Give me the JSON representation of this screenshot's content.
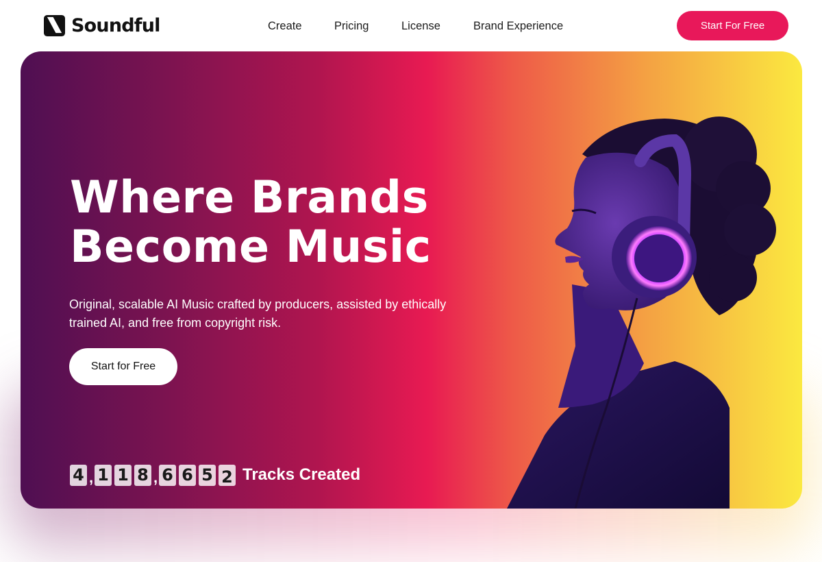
{
  "header": {
    "logo_text": "Soundful",
    "nav": [
      "Create",
      "Pricing",
      "License",
      "Brand Experience"
    ],
    "cta_label": "Start For Free",
    "cta_color": "#e8185a"
  },
  "hero": {
    "title_line1": "Where Brands",
    "title_line2": "Become Music",
    "subtitle": "Original, scalable AI Music crafted by producers, assisted by ethically trained AI, and free from copyright risk.",
    "cta_label": "Start for Free",
    "counter": {
      "digits": [
        "4",
        "1",
        "1",
        "8",
        "6",
        "6",
        "5",
        "2"
      ],
      "separator": ",",
      "label": "Tracks Created"
    },
    "image_subject": "woman-with-headphones",
    "gradient_colors": [
      "#4f0f52",
      "#e81a52",
      "#fbe940"
    ]
  },
  "icons": {
    "logo_mark": "soundful-s-logo-icon"
  }
}
